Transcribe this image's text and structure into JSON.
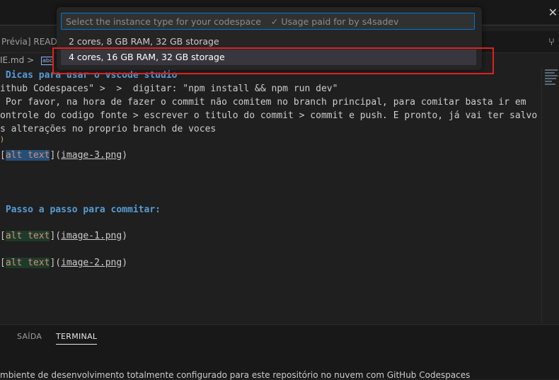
{
  "palette": {
    "placeholder": "Select the instance type for your codespace",
    "usage_note": "✓ Usage paid for by s4sadev",
    "options": [
      {
        "label": "2 cores, 8 GB RAM, 32 GB storage",
        "selected": false
      },
      {
        "label": "4 cores, 16 GB RAM, 32 GB storage",
        "selected": true
      }
    ]
  },
  "tabs": {
    "preview_tab": "Prévia] READM",
    "actions_icon": "branch-icon"
  },
  "breadcrumb": {
    "file": "IE.md",
    "sep": ">",
    "md_badge": "abc",
    "symbol": "# ["
  },
  "editor": {
    "lines": [
      {
        "kind": "heading",
        "text": " Dicas para usar o vscode studio"
      },
      {
        "kind": "plain",
        "text": "ithub Codespaces\" >  >  digitar: \"npm install && npm run dev\""
      },
      {
        "kind": "plain",
        "text": " Por favor, na hora de fazer o commit não comitem no branch principal, para comitar basta ir em"
      },
      {
        "kind": "plain",
        "text": "ontrole do codigo fonte > escrever o titulo do commit > commit e push. E pronto, já vai ter salvo"
      },
      {
        "kind": "plain",
        "text": "s alterações no proprio branch de voces"
      },
      {
        "kind": "marker",
        "text": ")"
      },
      {
        "kind": "image",
        "alt": "alt text",
        "src": "image-3.png"
      },
      {
        "kind": "heading2",
        "text": " Passo a passo para commitar:"
      },
      {
        "kind": "image",
        "alt": "alt text",
        "src": "image-1.png"
      },
      {
        "kind": "image",
        "alt": "alt text",
        "src": "image-2.png"
      }
    ]
  },
  "panel": {
    "tabs": [
      "SAÍDA",
      "TERMINAL"
    ],
    "active_tab": "TERMINAL",
    "terminal_line": "mbiente de desenvolvimento totalmente configurado para este repositório no nuvem com GitHub Codespaces"
  },
  "colors": {
    "highlight_border": "#e02020",
    "accent": "#0078d4",
    "heading": "#569cd6"
  }
}
